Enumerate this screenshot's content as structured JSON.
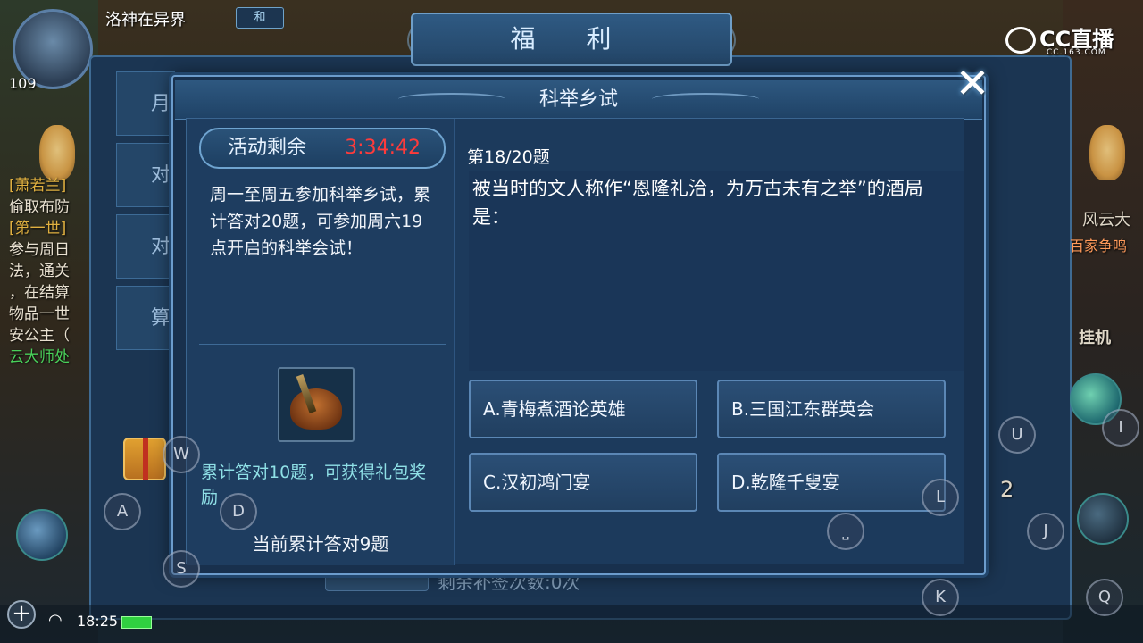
{
  "hud": {
    "player_name": "洛神在异界",
    "level": "109",
    "badge": "和",
    "time": "18:25"
  },
  "welfare": {
    "title": "福 利",
    "sidebar_tabs": [
      "月",
      "对",
      "对",
      "算"
    ],
    "remaining_label": "剩余补签次数:0次"
  },
  "left_chat": {
    "lines": [
      {
        "text": "[萧若兰]",
        "cls": "hl"
      },
      {
        "text": "偷取布防",
        "cls": ""
      },
      {
        "text": "[第一世]",
        "cls": "hl"
      },
      {
        "text": "参与周日",
        "cls": ""
      },
      {
        "text": "法，通关",
        "cls": ""
      },
      {
        "text": "，在结算",
        "cls": ""
      },
      {
        "text": "物品一世",
        "cls": ""
      },
      {
        "text": "安公主（",
        "cls": ""
      },
      {
        "text": "云大师处",
        "cls": "gr"
      }
    ]
  },
  "right_labels": {
    "fengyun": "风云大",
    "dijia": "百家争鸣",
    "guaji": "挂机",
    "number": "2"
  },
  "cc_logo": {
    "main": "CC直播",
    "sub": "CC.163.COM"
  },
  "exam": {
    "title": "科举乡试",
    "close_glyph": "✕",
    "timer_label": "活动剩余",
    "timer_value": "3:34:42",
    "description": "周一至周五参加科举乡试，累计答对20题，可参加周六19点开启的科举会试！",
    "reward_desc": "累计答对10题，可获得礼包奖励",
    "progress": "当前累计答对9题",
    "question_number": "第18/20题",
    "question": "被当时的文人称作“恩隆礼洽，为万古未有之举”的酒局是：",
    "options": [
      {
        "key": "A",
        "label": "A.青梅煮酒论英雄"
      },
      {
        "key": "B",
        "label": "B.三国江东群英会"
      },
      {
        "key": "C",
        "label": "C.汉初鸿门宴"
      },
      {
        "key": "D",
        "label": "D.乾隆千叟宴"
      }
    ]
  },
  "virtual_keys": {
    "w": "W",
    "a": "A",
    "d": "D",
    "s": "S",
    "u": "U",
    "i": "I",
    "l": "L",
    "j": "J",
    "k": "K",
    "q": "Q",
    "space": "⎵"
  },
  "colors": {
    "timer_red": "#ff3b3b",
    "reward_cyan": "#8fe0e6",
    "dialog_bg": "#18304d",
    "border_blue": "#6c9ccc"
  }
}
